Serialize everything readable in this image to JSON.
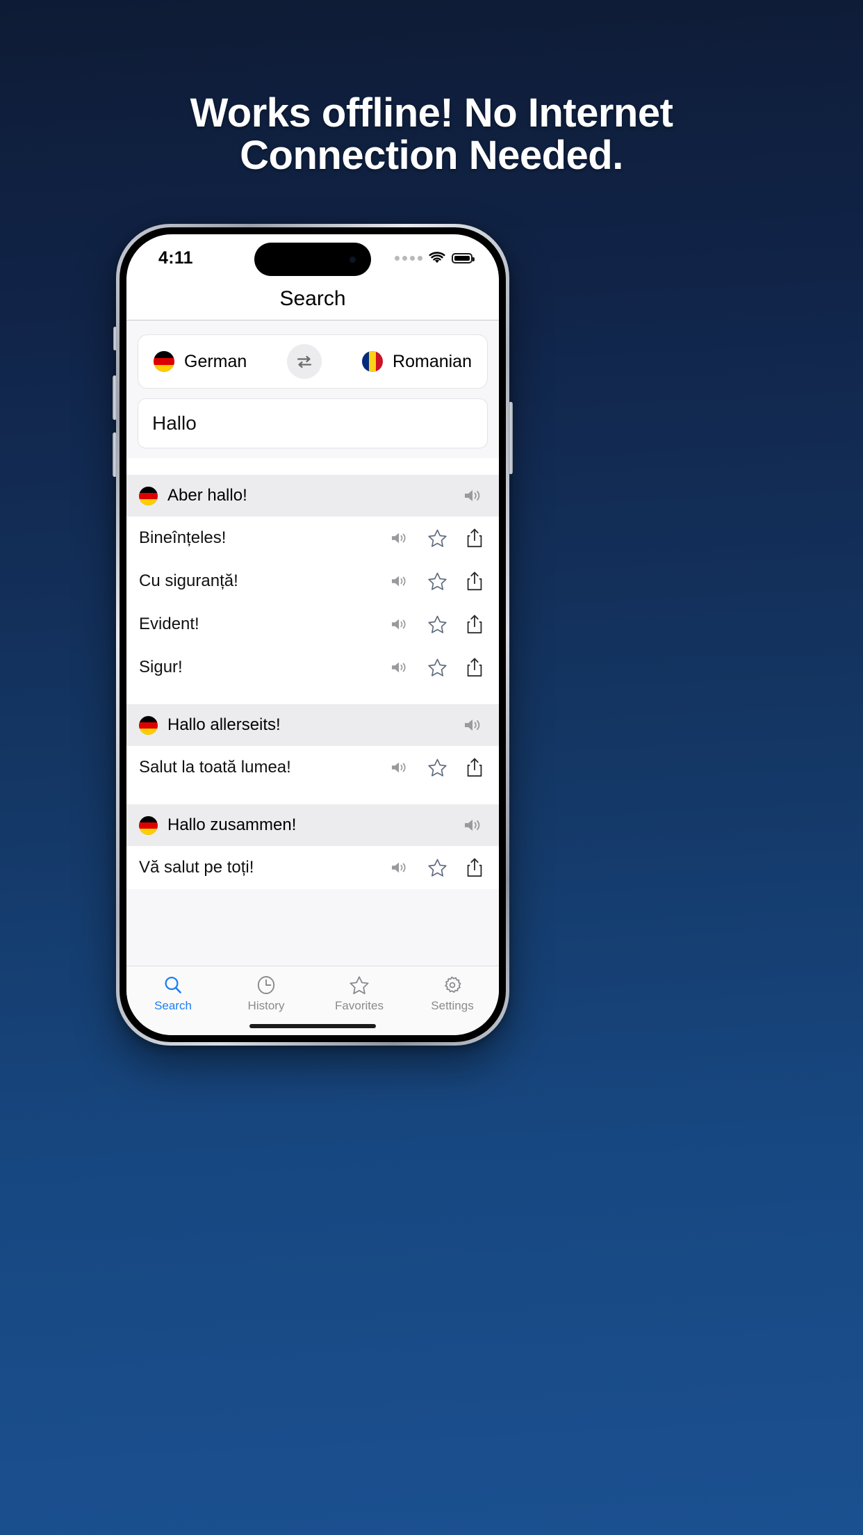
{
  "headline": {
    "line1": "Works offline! No Internet",
    "line2": "Connection Needed."
  },
  "status_bar": {
    "time": "4:11",
    "cellular": "cellular-dots",
    "wifi": "wifi-icon",
    "battery": "battery-icon"
  },
  "navbar": {
    "title": "Search"
  },
  "language_bar": {
    "source": {
      "label": "German",
      "flag": "de"
    },
    "swap": "swap-icon",
    "target": {
      "label": "Romanian",
      "flag": "ro"
    }
  },
  "search": {
    "value": "Hallo",
    "placeholder": "Hallo"
  },
  "results": [
    {
      "source": "Aber hallo!",
      "flag": "de",
      "translations": [
        "Bineînțeles!",
        "Cu siguranță!",
        "Evident!",
        "Sigur!"
      ]
    },
    {
      "source": "Hallo allerseits!",
      "flag": "de",
      "translations": [
        "Salut la toată lumea!"
      ]
    },
    {
      "source": "Hallo zusammen!",
      "flag": "de",
      "translations": [
        "Vă salut pe toți!"
      ]
    }
  ],
  "row_icons": {
    "speaker": "speaker-icon",
    "star": "star-icon",
    "share": "share-icon"
  },
  "tabs": [
    {
      "label": "Search",
      "icon": "search-icon",
      "active": true
    },
    {
      "label": "History",
      "icon": "clock-icon",
      "active": false
    },
    {
      "label": "Favorites",
      "icon": "star-icon",
      "active": false
    },
    {
      "label": "Settings",
      "icon": "gear-icon",
      "active": false
    }
  ],
  "colors": {
    "bg_top": "#0e1b35",
    "bg_bottom": "#1b5090",
    "accent": "#1c7ef3",
    "row_header_bg": "#ececee",
    "muted_text": "#8a8a8e"
  }
}
